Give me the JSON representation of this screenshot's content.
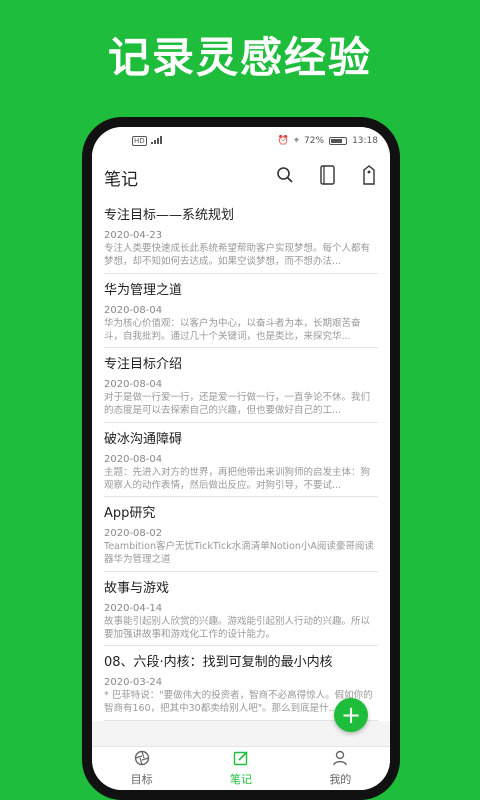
{
  "headline": "记录灵感经验",
  "status_bar": {
    "left": "HD",
    "battery": "72%",
    "time": "13:18"
  },
  "app_bar": {
    "title": "笔记"
  },
  "notes": [
    {
      "title": "专注目标——系统规划",
      "date": "2020-04-23",
      "preview": "专注人类要快速成长此系统希望帮助客户实现梦想。每个人都有梦想，却不知如何去达成。如果空谈梦想，而不想办法..."
    },
    {
      "title": "华为管理之道",
      "date": "2020-08-04",
      "preview": "华为核心价值观：以客户为中心，以奋斗者为本，长期艰苦奋斗，自我批判。通过几十个关键词，也是类比，来探究华..."
    },
    {
      "title": "专注目标介绍",
      "date": "2020-08-04",
      "preview": "对于是做一行爱一行，还是爱一行做一行，一直争论不休。我们的态度是可以去探索自己的兴趣，但也要做好自己的工..."
    },
    {
      "title": "破冰沟通障碍",
      "date": "2020-08-04",
      "preview": "主题：先进入对方的世界，再把他带出来训狗师的启发主体：狗观察人的动作表情，然后做出反应。对狗引导，不要试..."
    },
    {
      "title": "App研究",
      "date": "2020-08-02",
      "preview": "Teambition客户无忧TickTick水滴清单Notion小A阅读豪哥阅读器华为管理之道"
    },
    {
      "title": "故事与游戏",
      "date": "2020-04-14",
      "preview": "故事能引起别人欣赏的兴趣。游戏能引起别人行动的兴趣。所以要加强讲故事和游戏化工作的设计能力。"
    },
    {
      "title": "08、六段·内核：找到可复制的最小内核",
      "date": "2020-03-24",
      "preview": "* 巴菲特说：\"要做伟大的投资者，智商不必高得惊人。假如你的智商有160，把其中30都卖给别人吧\"。那么到底是什..."
    }
  ],
  "fab_label": "+",
  "tabs": [
    {
      "label": "目标",
      "icon": "aperture-icon"
    },
    {
      "label": "笔记",
      "icon": "edit-icon"
    },
    {
      "label": "我的",
      "icon": "user-icon"
    }
  ],
  "colors": {
    "brand": "#1fbd3c"
  }
}
